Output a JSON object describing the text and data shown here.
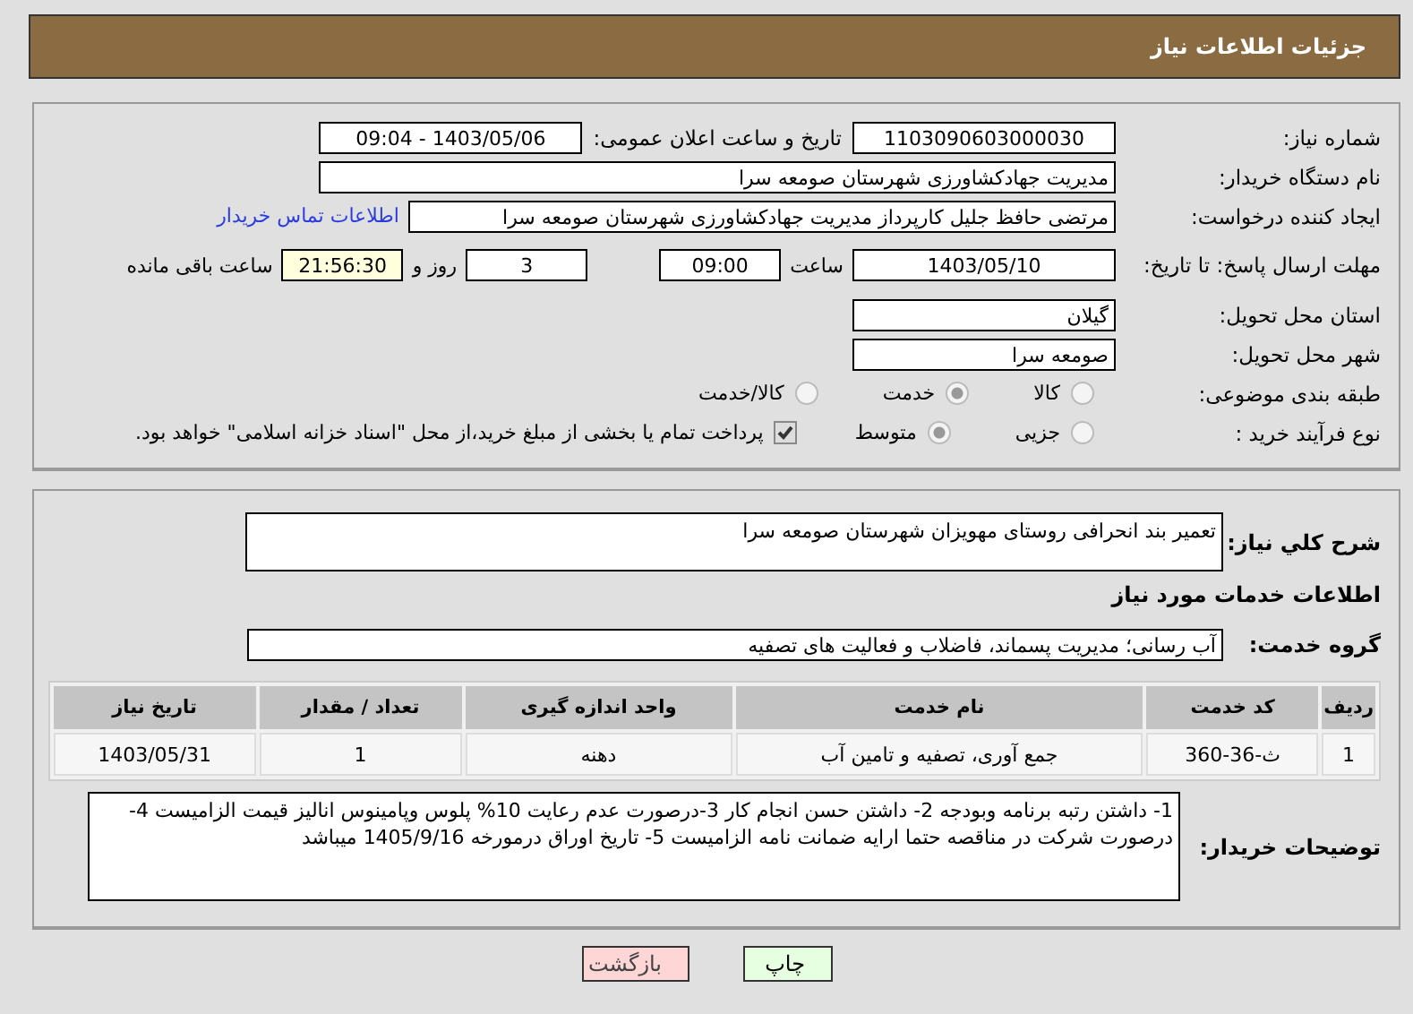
{
  "header": {
    "title": "جزئیات اطلاعات نیاز"
  },
  "need_number": {
    "label": "شماره نیاز:",
    "value": "1103090603000030"
  },
  "announce": {
    "label": "تاریخ و ساعت اعلان عمومی:",
    "value": "1403/05/06 - 09:04"
  },
  "buyer": {
    "label": "نام دستگاه خریدار:",
    "value": "مدیریت جهادکشاورزی شهرستان صومعه سرا"
  },
  "requester": {
    "label": "ایجاد کننده درخواست:",
    "value": "مرتضی حافظ جلیل کارپرداز مدیریت جهادکشاورزی شهرستان صومعه سرا",
    "link": "اطلاعات تماس خریدار"
  },
  "deadline": {
    "label": "مهلت ارسال پاسخ: تا تاریخ:",
    "date": "1403/05/10",
    "time_label": "ساعت",
    "time": "09:00",
    "days": "3",
    "days_label": "روز و",
    "remaining": "21:56:30",
    "remaining_label": "ساعت باقی مانده"
  },
  "province": {
    "label": "استان محل تحویل:",
    "value": "گیلان"
  },
  "city": {
    "label": "شهر محل تحویل:",
    "value": "صومعه سرا"
  },
  "category": {
    "label": "طبقه بندی موضوعی:",
    "options": [
      {
        "label": "کالا",
        "selected": false
      },
      {
        "label": "خدمت",
        "selected": true
      },
      {
        "label": "کالا/خدمت",
        "selected": false
      }
    ]
  },
  "purchase": {
    "label": "نوع فرآیند خرید :",
    "options": [
      {
        "label": "جزیی",
        "selected": false
      },
      {
        "label": "متوسط",
        "selected": true
      }
    ],
    "treasury": {
      "checked": true,
      "label": "پرداخت تمام یا بخشی از مبلغ خرید،از محل \"اسناد خزانه اسلامی\" خواهد بود."
    }
  },
  "summary": {
    "label": "شرح کلي نیاز:",
    "value": "تعمیر بند انحرافی روستای مهویزان شهرستان صومعه سرا"
  },
  "services_heading": "اطلاعات خدمات مورد نیاز",
  "service_group": {
    "label": "گروه خدمت:",
    "value": "آب رسانی؛ مدیریت پسماند، فاضلاب و فعالیت های تصفیه"
  },
  "table": {
    "columns": [
      "ردیف",
      "کد خدمت",
      "نام خدمت",
      "واحد اندازه گیری",
      "تعداد / مقدار",
      "تاریخ نیاز"
    ],
    "rows": [
      [
        "1",
        "ث-36-360",
        "جمع آوری، تصفیه و تامین آب",
        "دهنه",
        "1",
        "1403/05/31"
      ]
    ]
  },
  "notes": {
    "label": "توضیحات خریدار:",
    "value": "1- داشتن رتبه برنامه وبودجه 2- داشتن حسن انجام کار 3-درصورت عدم رعایت 10% پلوس وپامینوس انالیز قیمت الزامیست 4-درصورت شرکت در مناقصه حتما ارایه ضمانت نامه الزامیست 5- تاریخ اوراق درمورخه 1405/9/16 میباشد"
  },
  "buttons": [
    {
      "label": "چاپ",
      "kind": "print"
    },
    {
      "label": "بازگشت",
      "kind": "back"
    }
  ]
}
